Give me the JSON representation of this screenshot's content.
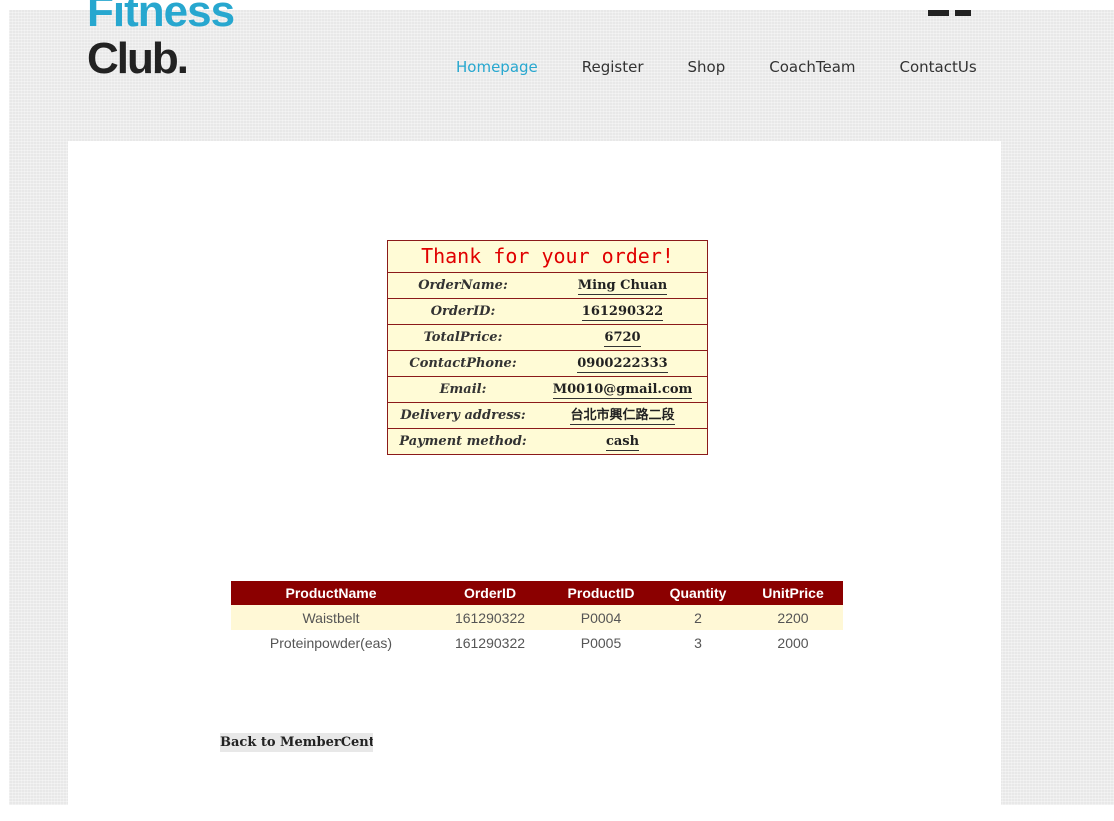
{
  "brand": {
    "line1": "Fitness",
    "line2": "Club."
  },
  "nav": [
    {
      "label": "Homepage",
      "active": true
    },
    {
      "label": "Register"
    },
    {
      "label": "Shop"
    },
    {
      "label": "CoachTeam"
    },
    {
      "label": "ContactUs"
    }
  ],
  "order": {
    "title": "Thank for your order!",
    "rows": [
      {
        "label": "OrderName:",
        "value": "Ming Chuan"
      },
      {
        "label": "OrderID:",
        "value": "161290322"
      },
      {
        "label": "TotalPrice:",
        "value": "6720"
      },
      {
        "label": "ContactPhone:",
        "value": "0900222333"
      },
      {
        "label": "Email:",
        "value": "M0010@gmail.com"
      },
      {
        "label": "Delivery address:",
        "value": "台北市興仁路二段"
      },
      {
        "label": "Payment method:",
        "value": "cash"
      }
    ]
  },
  "products": {
    "headers": [
      "ProductName",
      "OrderID",
      "ProductID",
      "Quantity",
      "UnitPrice"
    ],
    "rows": [
      [
        "Waistbelt",
        "161290322",
        "P0004",
        "2",
        "2200"
      ],
      [
        "Proteinpowder(eas)",
        "161290322",
        "P0005",
        "3",
        "2000"
      ]
    ]
  },
  "back_link": "Back to MemberCenter",
  "colors": {
    "accent": "#27a7cf",
    "header_red": "#8b0000",
    "title_red": "#e00000",
    "row_cream": "#fff8d6"
  }
}
